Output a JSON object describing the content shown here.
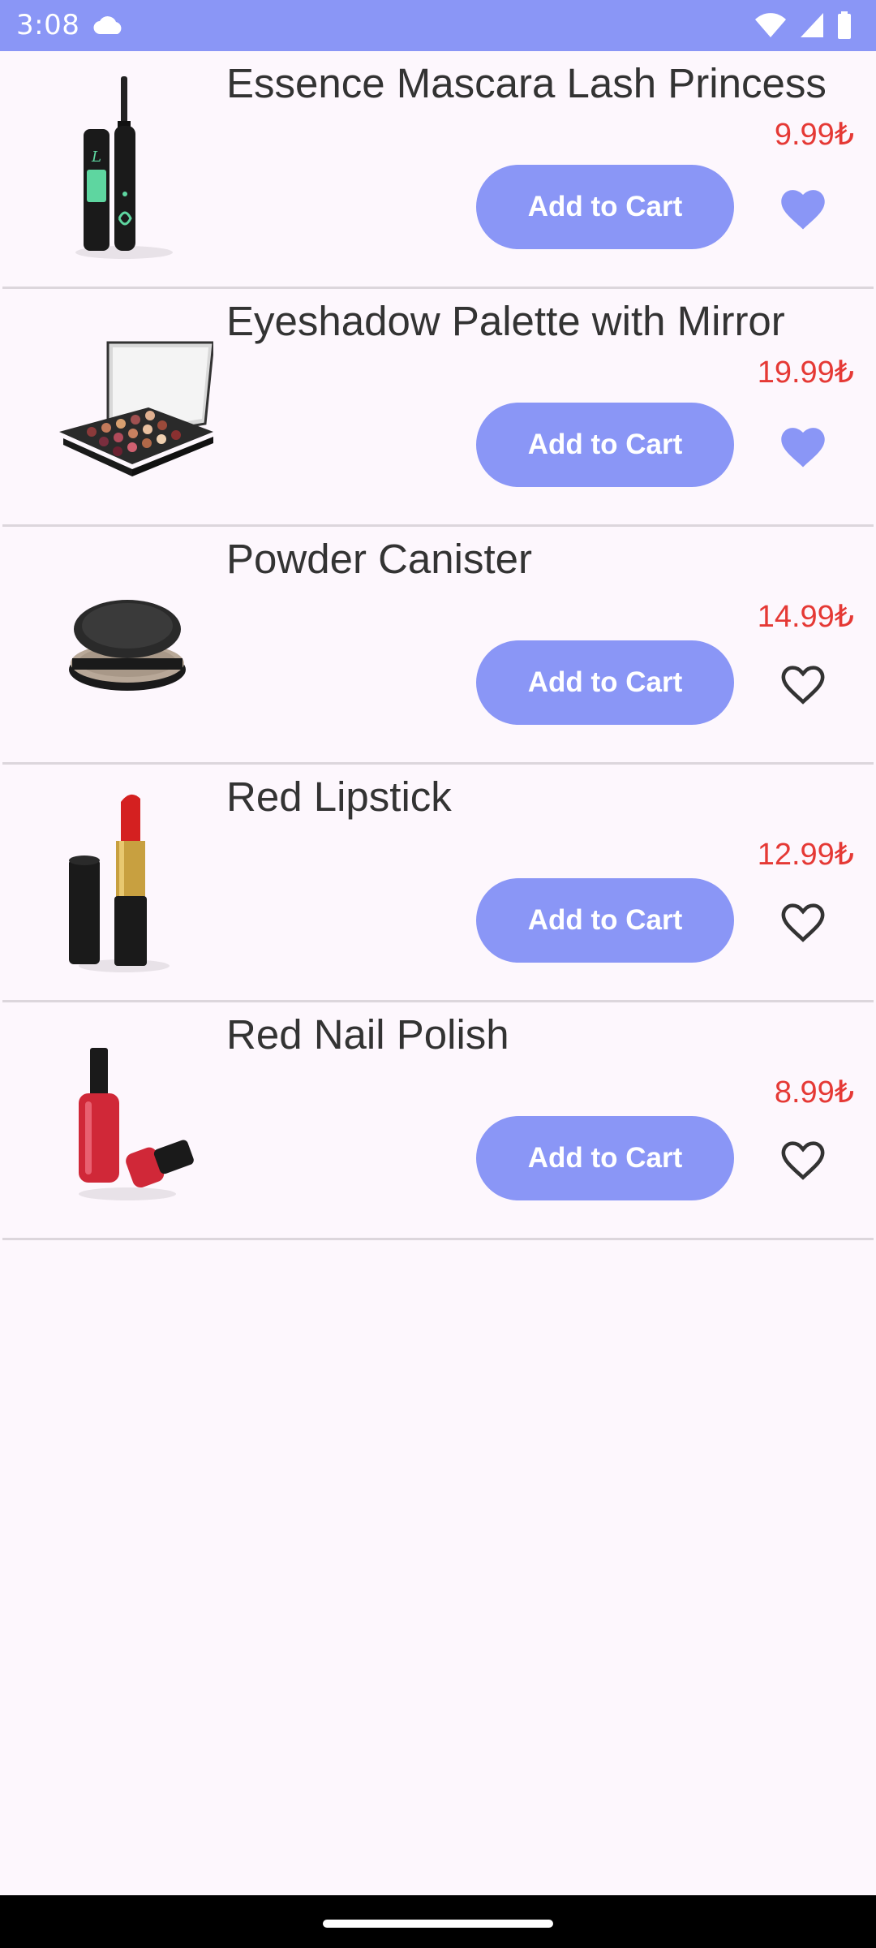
{
  "status_bar": {
    "time": "3:08",
    "cloud_icon": "cloud-icon",
    "wifi_icon": "wifi-icon",
    "signal_icon": "signal-icon",
    "battery_icon": "battery-icon"
  },
  "colors": {
    "accent": "#8a96f6",
    "price": "#e53935",
    "background": "#fdf7fd"
  },
  "products": [
    {
      "name": "Essence Mascara Lash Princess",
      "price": "9.99₺",
      "button_label": "Add to Cart",
      "favorite": true,
      "icon": "heart-filled-icon"
    },
    {
      "name": "Eyeshadow Palette with Mirror",
      "price": "19.99₺",
      "button_label": "Add to Cart",
      "favorite": true,
      "icon": "heart-filled-icon"
    },
    {
      "name": "Powder Canister",
      "price": "14.99₺",
      "button_label": "Add to Cart",
      "favorite": false,
      "icon": "heart-outline-icon"
    },
    {
      "name": "Red Lipstick",
      "price": "12.99₺",
      "button_label": "Add to Cart",
      "favorite": false,
      "icon": "heart-outline-icon"
    },
    {
      "name": "Red Nail Polish",
      "price": "8.99₺",
      "button_label": "Add to Cart",
      "favorite": false,
      "icon": "heart-outline-icon"
    }
  ]
}
